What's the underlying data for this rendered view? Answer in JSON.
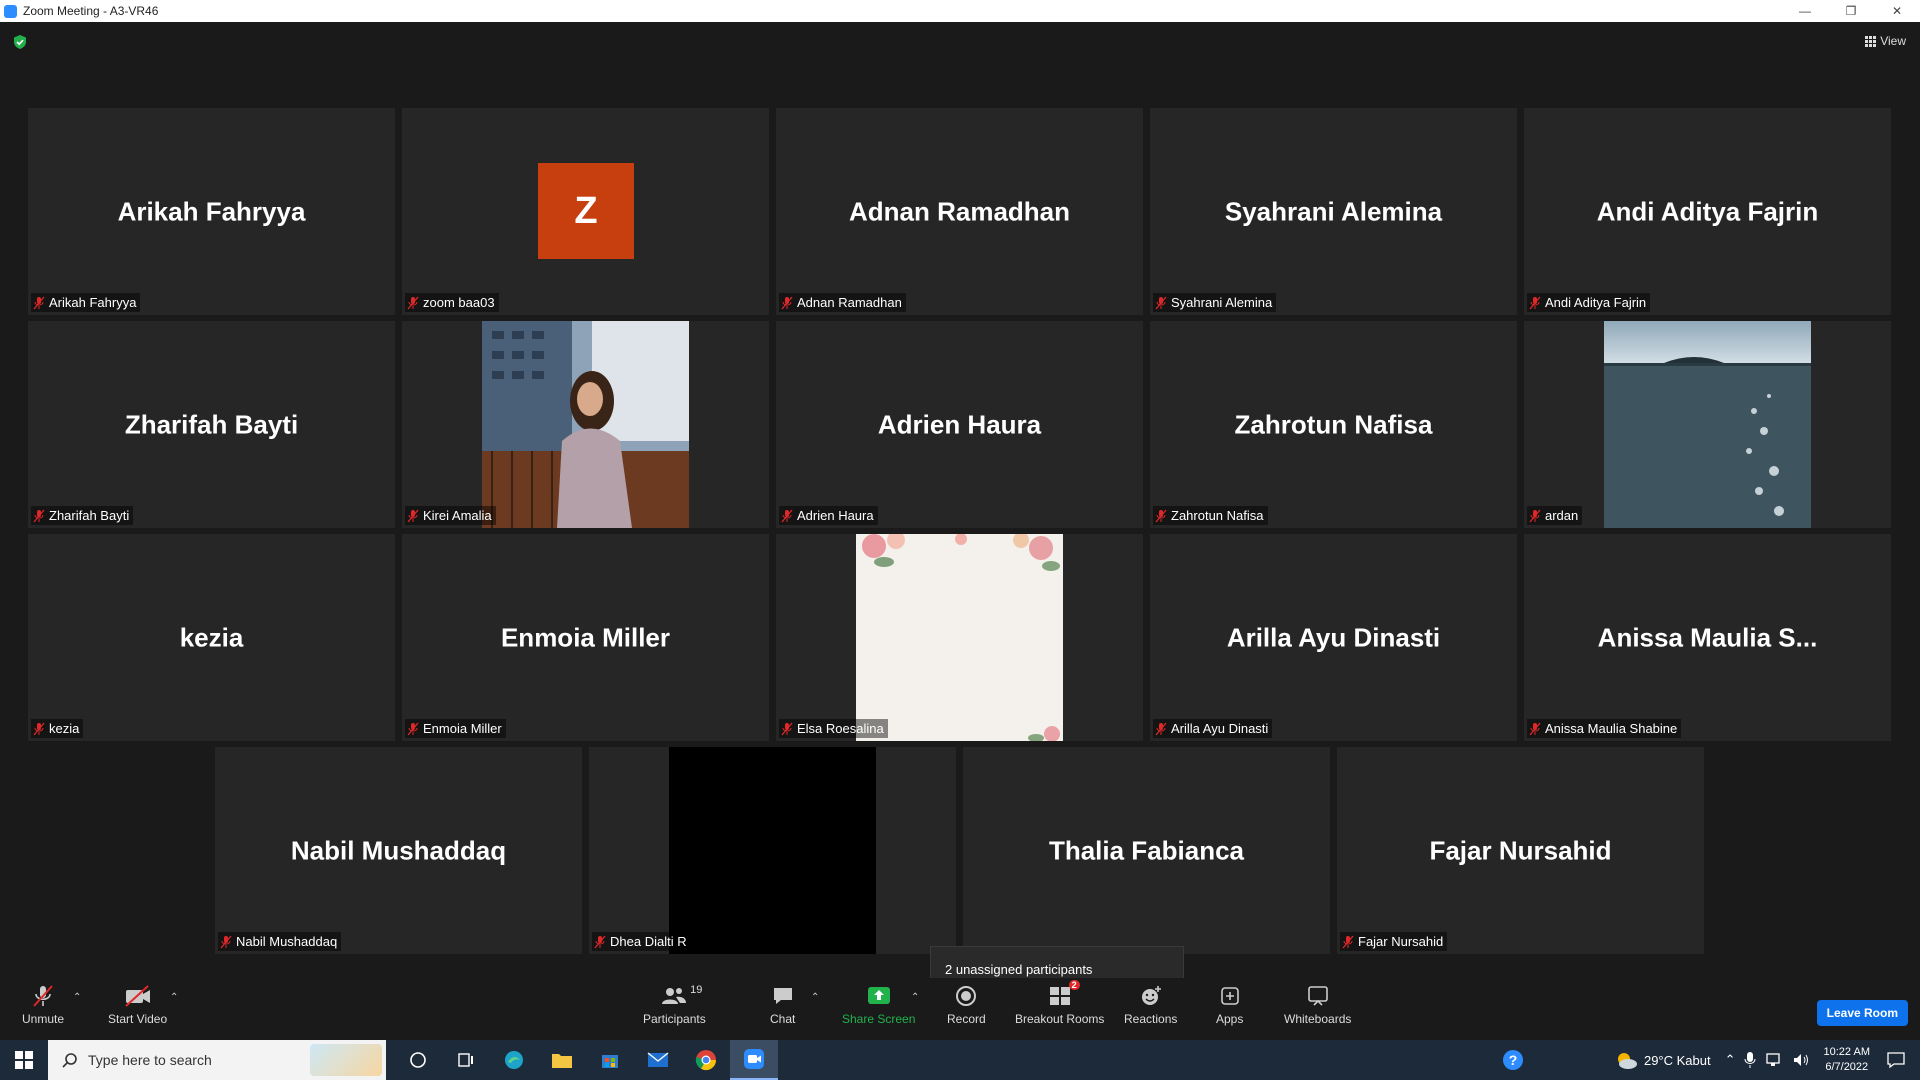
{
  "window": {
    "title": "Zoom Meeting - A3-VR46",
    "controls": [
      "minimize-icon",
      "restore-icon",
      "close-icon"
    ]
  },
  "header": {
    "view_label": "View",
    "security_icon": "shield-check-icon"
  },
  "tiles": [
    {
      "display_name": "Arikah Fahryya",
      "label": "Arikah Fahryya",
      "type": "name"
    },
    {
      "display_name": "",
      "label": "zoom baa03",
      "type": "avatar",
      "avatar_letter": "Z",
      "avatar_color": "#c83f0f"
    },
    {
      "display_name": "Adnan Ramadhan",
      "label": "Adnan Ramadhan",
      "type": "name"
    },
    {
      "display_name": "Syahrani Alemina",
      "label": "Syahrani Alemina",
      "type": "name"
    },
    {
      "display_name": "Andi Aditya Fajrin",
      "label": "Andi Aditya Fajrin",
      "type": "name"
    },
    {
      "display_name": "Zharifah Bayti",
      "label": "Zharifah Bayti",
      "type": "name"
    },
    {
      "display_name": "",
      "label": "Kirei Amalia",
      "type": "photo"
    },
    {
      "display_name": "Adrien Haura",
      "label": "Adrien Haura",
      "type": "name"
    },
    {
      "display_name": "Zahrotun Nafisa",
      "label": "Zahrotun Nafisa",
      "type": "name"
    },
    {
      "display_name": "",
      "label": "ardan",
      "type": "photo"
    },
    {
      "display_name": "kezia",
      "label": "kezia",
      "type": "name"
    },
    {
      "display_name": "Enmoia Miller",
      "label": "Enmoia Miller",
      "type": "name"
    },
    {
      "display_name": "",
      "label": "Elsa Roesalina",
      "type": "photo"
    },
    {
      "display_name": "Arilla Ayu Dinasti",
      "label": "Arilla Ayu Dinasti",
      "type": "name"
    },
    {
      "display_name": "Anissa Maulia S...",
      "label": "Anissa Maulia Shabine",
      "type": "name"
    },
    {
      "display_name": "Nabil Mushaddaq",
      "label": "Nabil Mushaddaq",
      "type": "name"
    },
    {
      "display_name": "",
      "label": "Dhea Dialti R",
      "type": "video"
    },
    {
      "display_name": "Thalia Fabianca",
      "label": "Thalia Fabianca",
      "type": "name"
    },
    {
      "display_name": "Fajar Nursahid",
      "label": "Fajar Nursahid",
      "type": "name"
    }
  ],
  "tooltip": {
    "text": "2 unassigned participants"
  },
  "toolbar": {
    "unmute": "Unmute",
    "start_video": "Start Video",
    "participants": "Participants",
    "participants_count": "19",
    "chat": "Chat",
    "share_screen": "Share Screen",
    "record": "Record",
    "breakout_rooms": "Breakout Rooms",
    "breakout_badge": "2",
    "reactions": "Reactions",
    "apps": "Apps",
    "whiteboards": "Whiteboards",
    "leave": "Leave Room"
  },
  "taskbar": {
    "search_placeholder": "Type here to search",
    "weather": "29°C  Kabut",
    "time": "10:22 AM",
    "date": "6/7/2022"
  },
  "colors": {
    "accent": "#0e72ed",
    "share_green": "#22b24c",
    "mic_off_red": "#e02828"
  }
}
